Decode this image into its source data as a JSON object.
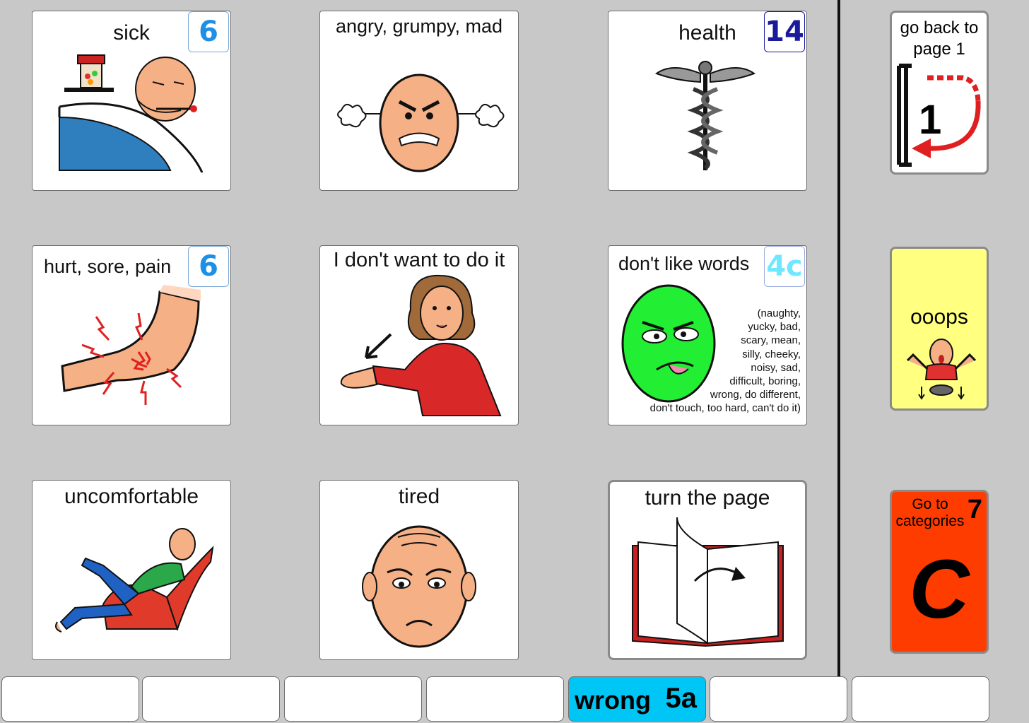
{
  "grid": [
    {
      "label": "sick",
      "badge": "6",
      "badge_color": "#1e8fe6"
    },
    {
      "label": "angry, grumpy, mad"
    },
    {
      "label": "health",
      "badge": "14",
      "badge_color": "#1a1a9c"
    },
    {
      "label": "hurt, sore, pain",
      "badge": "6",
      "badge_color": "#1e8fe6"
    },
    {
      "label": "I don't want to do it"
    },
    {
      "label": "don't like words",
      "badge": "4c",
      "badge_color": "#6fe8ff",
      "words": [
        "(naughty,",
        "yucky, bad,",
        "scary, mean,",
        "silly, cheeky,",
        "noisy, sad,",
        "difficult,  boring,",
        "wrong, do different,",
        "don't touch, too hard,  can't do it)"
      ]
    },
    {
      "label": "uncomfortable"
    },
    {
      "label": "tired"
    },
    {
      "label": "turn the page"
    }
  ],
  "side": {
    "back": {
      "line1": "go back to",
      "line2": "page 1",
      "number": "1"
    },
    "oops": {
      "label": "ooops"
    },
    "categories": {
      "line1": "Go to",
      "line2": "categories",
      "number": "7",
      "letter": "C"
    }
  },
  "strip": {
    "active_label": "wrong",
    "active_badge": "5a"
  },
  "colors": {
    "background": "#c8c8c8",
    "oops_bg": "#ffff80",
    "categories_bg": "#ff3c00",
    "strip_active": "#00c6f5"
  }
}
